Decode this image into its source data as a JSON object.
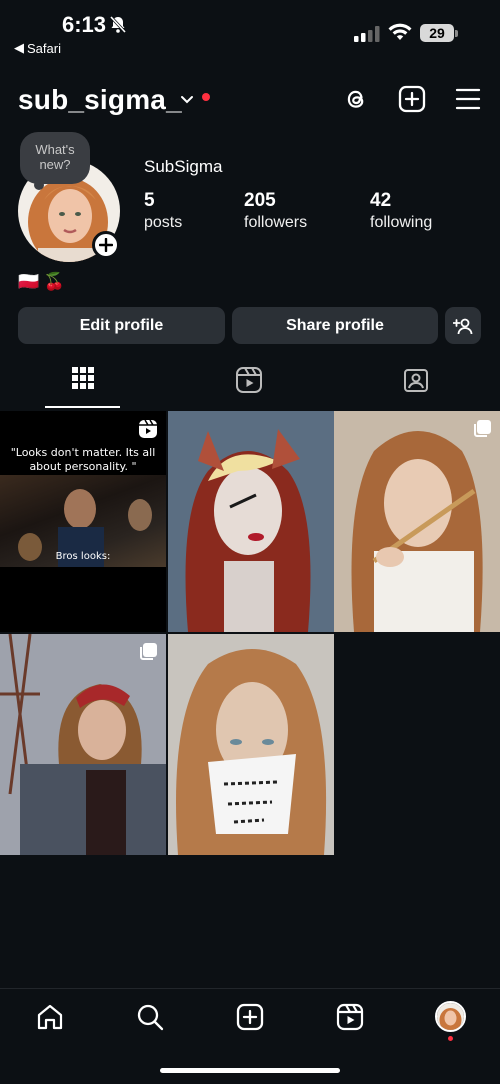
{
  "status_bar": {
    "time": "6:13",
    "back_app": "Safari",
    "battery": "29"
  },
  "header": {
    "username": "sub_sigma_"
  },
  "profile": {
    "note": "What's new?",
    "display_name": "SubSigma",
    "stats": [
      {
        "value": "5",
        "label": "posts"
      },
      {
        "value": "205",
        "label": "followers"
      },
      {
        "value": "42",
        "label": "following"
      }
    ],
    "bio_emojis": "🇵🇱 🍒"
  },
  "buttons": {
    "edit": "Edit profile",
    "share": "Share profile"
  },
  "posts": [
    {
      "type": "reel",
      "top_text": "\"Looks don't matter. Its all about personality. \"",
      "caption": "Bros looks:"
    },
    {
      "type": "photo"
    },
    {
      "type": "carousel"
    },
    {
      "type": "carousel"
    },
    {
      "type": "photo"
    }
  ],
  "icons": {
    "header": [
      "chevron-down-icon",
      "threads-icon",
      "add-post-icon",
      "menu-icon"
    ],
    "tabs": [
      "grid-icon",
      "reels-icon",
      "tagged-icon"
    ],
    "nav": [
      "home-icon",
      "search-icon",
      "create-icon",
      "reels-icon",
      "profile-avatar"
    ]
  },
  "colors": {
    "background": "#0c1014",
    "button": "#2b3036",
    "notification": "#ff3040"
  }
}
